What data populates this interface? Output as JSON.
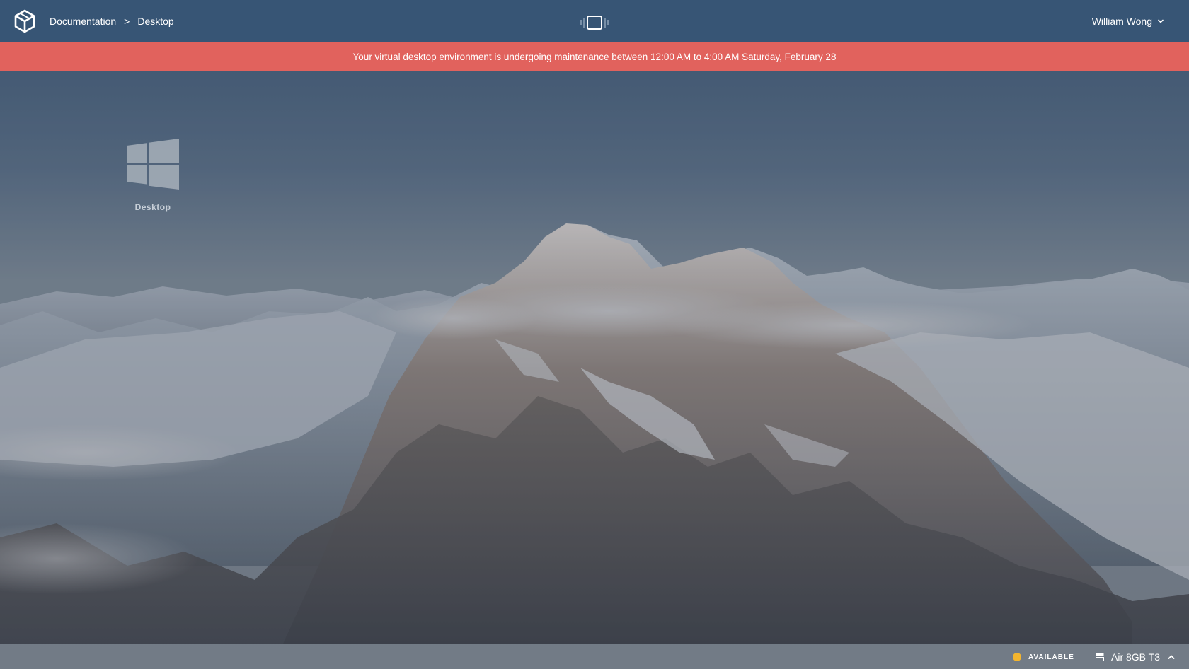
{
  "topbar": {
    "breadcrumb": [
      "Documentation",
      "Desktop"
    ],
    "separator": ">",
    "user_name": "William Wong"
  },
  "banner": {
    "message": "Your virtual desktop environment is undergoing maintenance between 12:00 AM to 4:00 AM Saturday, February 28"
  },
  "desktop": {
    "icon_label": "Desktop",
    "icon_name": "windows-logo-icon"
  },
  "statusbar": {
    "status_label": "AVAILABLE",
    "status_color": "#f4b52e",
    "machine_label": "Air 8GB T3"
  },
  "colors": {
    "topbar": "#375575",
    "banner": "#e1625d"
  }
}
